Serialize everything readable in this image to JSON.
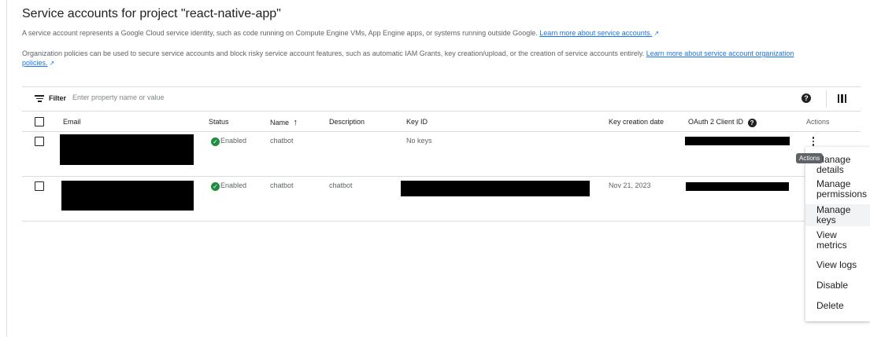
{
  "page": {
    "title": "Service accounts for project \"react-native-app\"",
    "desc1": "A service account represents a Google Cloud service identity, such as code running on Compute Engine VMs, App Engine apps, or systems running outside Google.",
    "desc1_link": "Learn more about service accounts.",
    "desc2": "Organization policies can be used to secure service accounts and block risky service account features, such as automatic IAM Grants, key creation/upload, or the creation of service accounts entirely.",
    "desc2_link_a": "Learn more about service account organization",
    "desc2_link_b": "policies."
  },
  "filter": {
    "label": "Filter",
    "placeholder": "Enter property name or value",
    "help_glyph": "?"
  },
  "table": {
    "columns": {
      "email": "Email",
      "status": "Status",
      "name": "Name",
      "sort_arrow": "↑",
      "description": "Description",
      "key_id": "Key ID",
      "key_date": "Key creation date",
      "oauth": "OAuth 2 Client ID",
      "actions": "Actions"
    },
    "rows": [
      {
        "status": "Enabled",
        "name": "chatbot",
        "description": "",
        "key_id": "No keys",
        "key_date": ""
      },
      {
        "status": "Enabled",
        "name": "chatbot",
        "description": "chatbot",
        "key_id": "",
        "key_date": "Nov 21, 2023"
      }
    ]
  },
  "tooltip": "Actions",
  "menu": {
    "items": [
      {
        "line1": "Manage",
        "line2": "details"
      },
      {
        "line1": "Manage",
        "line2": "permissions"
      },
      {
        "line1": "Manage",
        "line2": "keys"
      },
      {
        "line1": "View",
        "line2": "metrics"
      },
      {
        "line1": "View logs"
      },
      {
        "line1": "Disable"
      },
      {
        "line1": "Delete"
      }
    ],
    "highlighted_index": 2
  },
  "colors": {
    "link": "#1a73e8",
    "enabled": "#1e8e3e",
    "text": "#202124",
    "muted": "#5f6368"
  },
  "icons": [
    "filter-icon",
    "help-icon",
    "column-display-icon",
    "sort-up-icon",
    "check-circle-icon",
    "more-vert-icon",
    "external-link-icon"
  ]
}
